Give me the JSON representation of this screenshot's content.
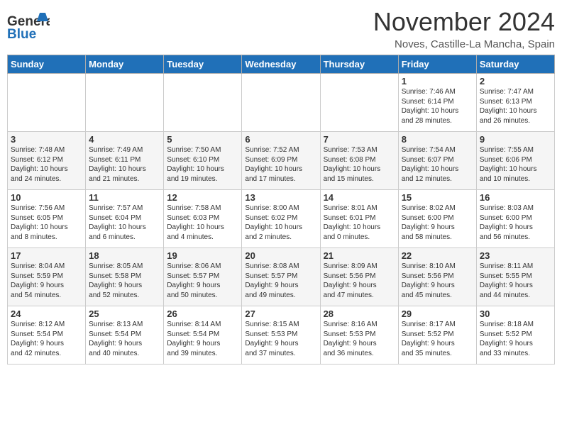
{
  "header": {
    "logo_general": "General",
    "logo_blue": "Blue",
    "month_title": "November 2024",
    "subtitle": "Noves, Castille-La Mancha, Spain"
  },
  "weekdays": [
    "Sunday",
    "Monday",
    "Tuesday",
    "Wednesday",
    "Thursday",
    "Friday",
    "Saturday"
  ],
  "weeks": [
    [
      {
        "day": "",
        "info": ""
      },
      {
        "day": "",
        "info": ""
      },
      {
        "day": "",
        "info": ""
      },
      {
        "day": "",
        "info": ""
      },
      {
        "day": "",
        "info": ""
      },
      {
        "day": "1",
        "info": "Sunrise: 7:46 AM\nSunset: 6:14 PM\nDaylight: 10 hours\nand 28 minutes."
      },
      {
        "day": "2",
        "info": "Sunrise: 7:47 AM\nSunset: 6:13 PM\nDaylight: 10 hours\nand 26 minutes."
      }
    ],
    [
      {
        "day": "3",
        "info": "Sunrise: 7:48 AM\nSunset: 6:12 PM\nDaylight: 10 hours\nand 24 minutes."
      },
      {
        "day": "4",
        "info": "Sunrise: 7:49 AM\nSunset: 6:11 PM\nDaylight: 10 hours\nand 21 minutes."
      },
      {
        "day": "5",
        "info": "Sunrise: 7:50 AM\nSunset: 6:10 PM\nDaylight: 10 hours\nand 19 minutes."
      },
      {
        "day": "6",
        "info": "Sunrise: 7:52 AM\nSunset: 6:09 PM\nDaylight: 10 hours\nand 17 minutes."
      },
      {
        "day": "7",
        "info": "Sunrise: 7:53 AM\nSunset: 6:08 PM\nDaylight: 10 hours\nand 15 minutes."
      },
      {
        "day": "8",
        "info": "Sunrise: 7:54 AM\nSunset: 6:07 PM\nDaylight: 10 hours\nand 12 minutes."
      },
      {
        "day": "9",
        "info": "Sunrise: 7:55 AM\nSunset: 6:06 PM\nDaylight: 10 hours\nand 10 minutes."
      }
    ],
    [
      {
        "day": "10",
        "info": "Sunrise: 7:56 AM\nSunset: 6:05 PM\nDaylight: 10 hours\nand 8 minutes."
      },
      {
        "day": "11",
        "info": "Sunrise: 7:57 AM\nSunset: 6:04 PM\nDaylight: 10 hours\nand 6 minutes."
      },
      {
        "day": "12",
        "info": "Sunrise: 7:58 AM\nSunset: 6:03 PM\nDaylight: 10 hours\nand 4 minutes."
      },
      {
        "day": "13",
        "info": "Sunrise: 8:00 AM\nSunset: 6:02 PM\nDaylight: 10 hours\nand 2 minutes."
      },
      {
        "day": "14",
        "info": "Sunrise: 8:01 AM\nSunset: 6:01 PM\nDaylight: 10 hours\nand 0 minutes."
      },
      {
        "day": "15",
        "info": "Sunrise: 8:02 AM\nSunset: 6:00 PM\nDaylight: 9 hours\nand 58 minutes."
      },
      {
        "day": "16",
        "info": "Sunrise: 8:03 AM\nSunset: 6:00 PM\nDaylight: 9 hours\nand 56 minutes."
      }
    ],
    [
      {
        "day": "17",
        "info": "Sunrise: 8:04 AM\nSunset: 5:59 PM\nDaylight: 9 hours\nand 54 minutes."
      },
      {
        "day": "18",
        "info": "Sunrise: 8:05 AM\nSunset: 5:58 PM\nDaylight: 9 hours\nand 52 minutes."
      },
      {
        "day": "19",
        "info": "Sunrise: 8:06 AM\nSunset: 5:57 PM\nDaylight: 9 hours\nand 50 minutes."
      },
      {
        "day": "20",
        "info": "Sunrise: 8:08 AM\nSunset: 5:57 PM\nDaylight: 9 hours\nand 49 minutes."
      },
      {
        "day": "21",
        "info": "Sunrise: 8:09 AM\nSunset: 5:56 PM\nDaylight: 9 hours\nand 47 minutes."
      },
      {
        "day": "22",
        "info": "Sunrise: 8:10 AM\nSunset: 5:56 PM\nDaylight: 9 hours\nand 45 minutes."
      },
      {
        "day": "23",
        "info": "Sunrise: 8:11 AM\nSunset: 5:55 PM\nDaylight: 9 hours\nand 44 minutes."
      }
    ],
    [
      {
        "day": "24",
        "info": "Sunrise: 8:12 AM\nSunset: 5:54 PM\nDaylight: 9 hours\nand 42 minutes."
      },
      {
        "day": "25",
        "info": "Sunrise: 8:13 AM\nSunset: 5:54 PM\nDaylight: 9 hours\nand 40 minutes."
      },
      {
        "day": "26",
        "info": "Sunrise: 8:14 AM\nSunset: 5:54 PM\nDaylight: 9 hours\nand 39 minutes."
      },
      {
        "day": "27",
        "info": "Sunrise: 8:15 AM\nSunset: 5:53 PM\nDaylight: 9 hours\nand 37 minutes."
      },
      {
        "day": "28",
        "info": "Sunrise: 8:16 AM\nSunset: 5:53 PM\nDaylight: 9 hours\nand 36 minutes."
      },
      {
        "day": "29",
        "info": "Sunrise: 8:17 AM\nSunset: 5:52 PM\nDaylight: 9 hours\nand 35 minutes."
      },
      {
        "day": "30",
        "info": "Sunrise: 8:18 AM\nSunset: 5:52 PM\nDaylight: 9 hours\nand 33 minutes."
      }
    ]
  ]
}
